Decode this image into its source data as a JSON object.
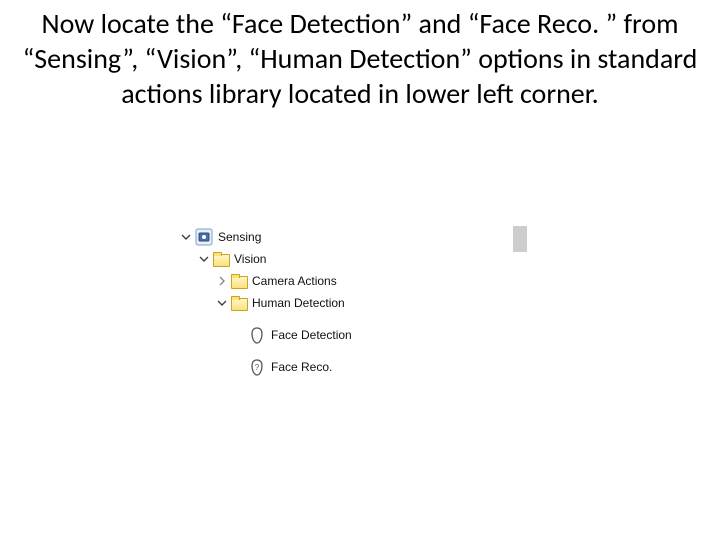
{
  "instruction_text": "Now locate the “Face Detection” and “Face Reco. ” from “Sensing”, “Vision”, “Human Detection” options in standard actions library located in lower left corner.",
  "tree": {
    "sensing": {
      "label": "Sensing",
      "expanded": true
    },
    "vision": {
      "label": "Vision",
      "expanded": true
    },
    "camera_actions": {
      "label": "Camera Actions",
      "expanded": false
    },
    "human_detection": {
      "label": "Human Detection",
      "expanded": true
    },
    "face_detection": {
      "label": "Face Detection"
    },
    "face_reco": {
      "label": "Face Reco."
    }
  }
}
